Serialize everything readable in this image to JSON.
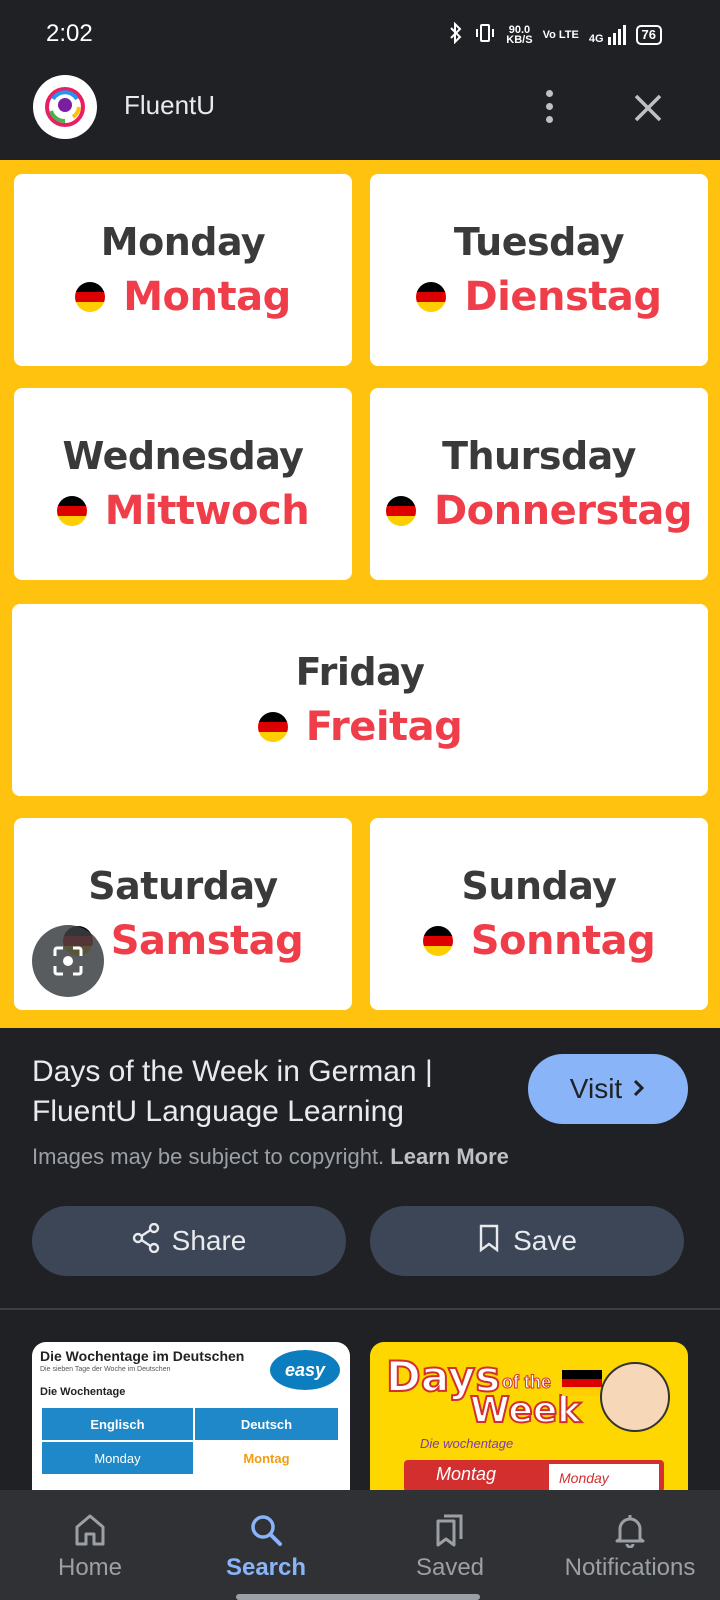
{
  "status_bar": {
    "time": "2:02",
    "speed_top": "90.0",
    "speed_bottom": "KB/S",
    "volte": "Vo LTE",
    "network": "4G",
    "battery": "76"
  },
  "header": {
    "app_name": "FluentU",
    "icons": [
      "more-vert-icon",
      "close-icon"
    ]
  },
  "image": {
    "cards": [
      {
        "en": "Monday",
        "de": "Montag"
      },
      {
        "en": "Tuesday",
        "de": "Dienstag"
      },
      {
        "en": "Wednesday",
        "de": "Mittwoch"
      },
      {
        "en": "Thursday",
        "de": "Donnerstag"
      },
      {
        "en": "Friday",
        "de": "Freitag"
      },
      {
        "en": "Saturday",
        "de": "Samstag"
      },
      {
        "en": "Sunday",
        "de": "Sonntag"
      }
    ],
    "background_color": "#ffc20e",
    "english_color": "#3a3a3a",
    "german_color": "#ef3e4a"
  },
  "result": {
    "title": "Days of the Week in German | FluentU Language Learning",
    "visit_label": "Visit",
    "copyright_text": "Images may be subject to copyright.",
    "learn_more": "Learn More"
  },
  "actions": {
    "share_label": "Share",
    "save_label": "Save"
  },
  "related": {
    "thumb1": {
      "title": "Die Wochentage im Deutschen",
      "subtitle": "Die sieben Tage der Woche im Deutschen",
      "heading": "Die Wochentage",
      "logo": "easy",
      "col1": "Englisch",
      "col2": "Deutsch",
      "row_en": "Monday",
      "row_de": "Montag"
    },
    "thumb2": {
      "days": "Days",
      "of_the": "of the",
      "week": "Week",
      "subtitle": "Die wochentage",
      "row_de": "Montag",
      "row_en": "Monday"
    }
  },
  "nav": {
    "items": [
      {
        "label": "Home",
        "icon": "home-icon"
      },
      {
        "label": "Search",
        "icon": "search-icon"
      },
      {
        "label": "Saved",
        "icon": "bookmarks-icon"
      },
      {
        "label": "Notifications",
        "icon": "bell-icon"
      }
    ],
    "active": "Search",
    "accent": "#8ab4f8"
  }
}
